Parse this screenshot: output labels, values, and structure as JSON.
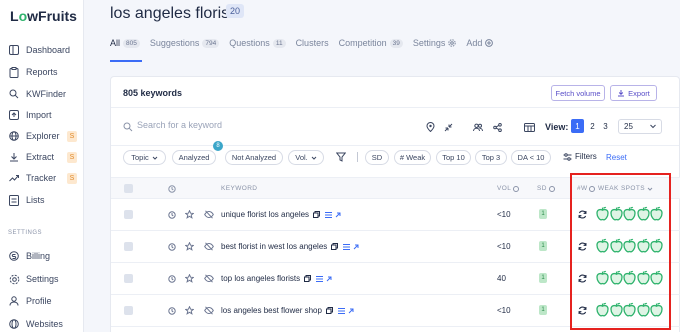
{
  "brand": {
    "logo_text": "LowFruits",
    "accent": "#2fb36d",
    "primary": "#3b6cf6",
    "highlight": "#e5221f"
  },
  "sidebar": {
    "items": [
      {
        "label": "Dashboard",
        "icon": "grid-icon"
      },
      {
        "label": "Reports",
        "icon": "clipboard-icon"
      },
      {
        "label": "KWFinder",
        "icon": "search-icon"
      },
      {
        "label": "Import",
        "icon": "upload-icon"
      },
      {
        "label": "Explorer",
        "icon": "globe-icon",
        "badge": "S"
      },
      {
        "label": "Extract",
        "icon": "download-icon",
        "badge": "S"
      },
      {
        "label": "Tracker",
        "icon": "trend-icon",
        "badge": "S"
      },
      {
        "label": "Lists",
        "icon": "list-icon"
      }
    ],
    "section_label": "SETTINGS",
    "settings_items": [
      {
        "label": "Billing",
        "icon": "card-icon"
      },
      {
        "label": "Settings",
        "icon": "gear-icon"
      },
      {
        "label": "Profile",
        "icon": "user-icon"
      },
      {
        "label": "Websites",
        "icon": "globe-icon"
      }
    ]
  },
  "header": {
    "title": "los angeles florist",
    "title_badge": "20"
  },
  "tabs": [
    {
      "label": "All",
      "count": "805",
      "active": true
    },
    {
      "label": "Suggestions",
      "count": "794"
    },
    {
      "label": "Questions",
      "count": "11"
    },
    {
      "label": "Clusters",
      "count": ""
    },
    {
      "label": "Competition",
      "count": "39"
    },
    {
      "label": "Settings",
      "count": ""
    },
    {
      "label": "Add",
      "count": ""
    }
  ],
  "card": {
    "keyword_count": "805 keywords",
    "fetch_volume": "Fetch volume",
    "export": "Export",
    "search_placeholder": "Search for a keyword",
    "view_label": "View:",
    "view_options": [
      "1",
      "2",
      "3"
    ],
    "per_page": "25"
  },
  "filters": {
    "chips": [
      "Topic",
      "Analyzed",
      "Not Analyzed",
      "Vol.",
      "SD",
      "# Weak",
      "Top 10",
      "Top 3",
      "DA < 10"
    ],
    "analyzed_badge": "8",
    "filters_label": "Filters",
    "reset_label": "Reset"
  },
  "table": {
    "headers": {
      "keyword": "KEYWORD",
      "vol": "VOL",
      "sd": "SD",
      "weak_count": "#W",
      "weak_spots": "WEAK SPOTS"
    },
    "rows": [
      {
        "keyword": "unique florist los angeles",
        "vol": "<10",
        "sd": "1"
      },
      {
        "keyword": "best florist in west los angeles",
        "vol": "<10",
        "sd": "1"
      },
      {
        "keyword": "top los angeles florists",
        "vol": "40",
        "sd": "1"
      },
      {
        "keyword": "los angeles best flower shop",
        "vol": "<10",
        "sd": "1"
      }
    ]
  }
}
